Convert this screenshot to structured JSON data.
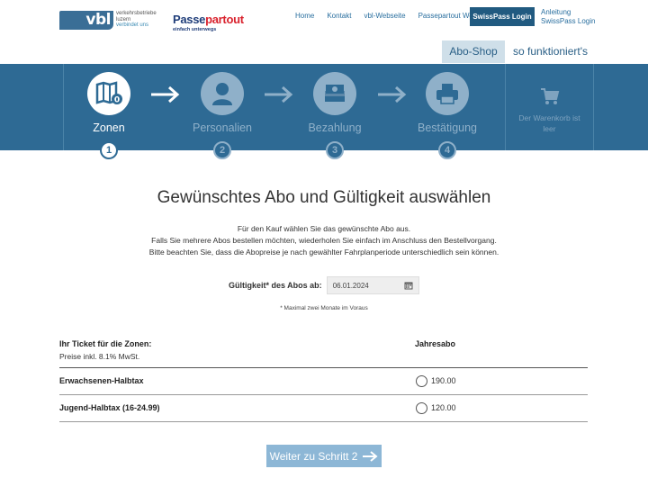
{
  "header": {
    "vbl_logo": {
      "mark": "vbl",
      "line1": "verkehrsbetriebe",
      "line2": "luzern",
      "tagline": "verbindet uns"
    },
    "pp_logo": {
      "name_main": "Passe",
      "name_accent": "partout",
      "tagline": "einfach unterwegs"
    },
    "nav": [
      "Home",
      "Kontakt",
      "vbl-Webseite",
      "Passepartout Website"
    ],
    "swisspass_login": "SwissPass Login",
    "help_links": [
      "Anleitung",
      "SwissPass Login"
    ]
  },
  "subnav": {
    "abo_shop": "Abo-Shop",
    "how_it_works": "so funktioniert's"
  },
  "steps": [
    {
      "label": "Zonen",
      "number": "1",
      "icon": "map-zones-icon",
      "active": true
    },
    {
      "label": "Personalien",
      "number": "2",
      "icon": "person-icon",
      "active": false
    },
    {
      "label": "Bezahlung",
      "number": "3",
      "icon": "money-icon",
      "active": false
    },
    {
      "label": "Bestätigung",
      "number": "4",
      "icon": "printer-icon",
      "active": false
    }
  ],
  "cart": {
    "icon": "cart-icon",
    "line1": "Der Warenkorb ist",
    "line2": "leer"
  },
  "main": {
    "title": "Gewünschtes Abo und Gültigkeit auswählen",
    "intro": [
      "Für den Kauf wählen Sie das gewünschte Abo aus.",
      "Falls Sie mehrere Abos bestellen möchten, wiederholen Sie einfach im Anschluss den Bestellvorgang.",
      "Bitte beachten Sie, dass die Abopreise je nach gewählter Fahrplanperiode unterschiedlich sein können."
    ],
    "validity_label": "Gültigkeit* des Abos ab:",
    "validity_date": "06.01.2024",
    "note": "* Maximal zwei Monate im Voraus"
  },
  "table": {
    "header_zones": "Ihr Ticket für die Zonen:",
    "header_vat": "Preise inkl. 8.1% MwSt.",
    "header_year": "Jahresabo",
    "rows": [
      {
        "label": "Erwachsenen-Halbtax",
        "price": "190.00"
      },
      {
        "label": "Jugend-Halbtax (16-24.99)",
        "price": "120.00"
      }
    ]
  },
  "next_button": "Weiter zu Schritt 2",
  "colors": {
    "band": "#2e6a94",
    "accent": "#215a80",
    "button": "#8db7d6"
  }
}
